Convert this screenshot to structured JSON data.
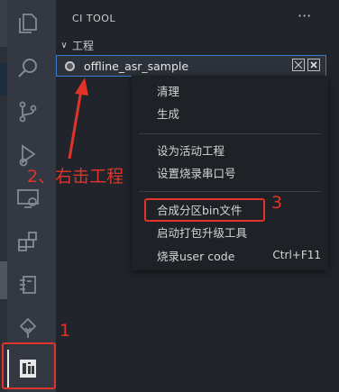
{
  "activity_icons": [
    "explorer-icon",
    "search-icon",
    "source-control-icon",
    "run-debug-icon",
    "remote-explorer-icon",
    "extensions-icon",
    "device-icon",
    "tree-icon",
    "ci-tool-icon"
  ],
  "sidebar": {
    "title": "CI TOOL",
    "more": "···"
  },
  "section": {
    "label": "工程"
  },
  "project": {
    "name": "offline_asr_sample"
  },
  "context_menu": {
    "items": [
      {
        "label": "清理",
        "shortcut": ""
      },
      {
        "label": "生成",
        "shortcut": ""
      },
      {
        "label": "设为活动工程",
        "shortcut": ""
      },
      {
        "label": "设置烧录串口号",
        "shortcut": ""
      },
      {
        "label": "合成分区bin文件",
        "shortcut": ""
      },
      {
        "label": "启动打包升级工具",
        "shortcut": ""
      },
      {
        "label": "烧录user code",
        "shortcut": "Ctrl+F11"
      }
    ]
  },
  "annotations": {
    "step1": "1",
    "step2": "2、右击工程",
    "step3": "3"
  },
  "colors": {
    "annotation_red": "#e0342a",
    "selection_border": "#3b7bcc"
  }
}
